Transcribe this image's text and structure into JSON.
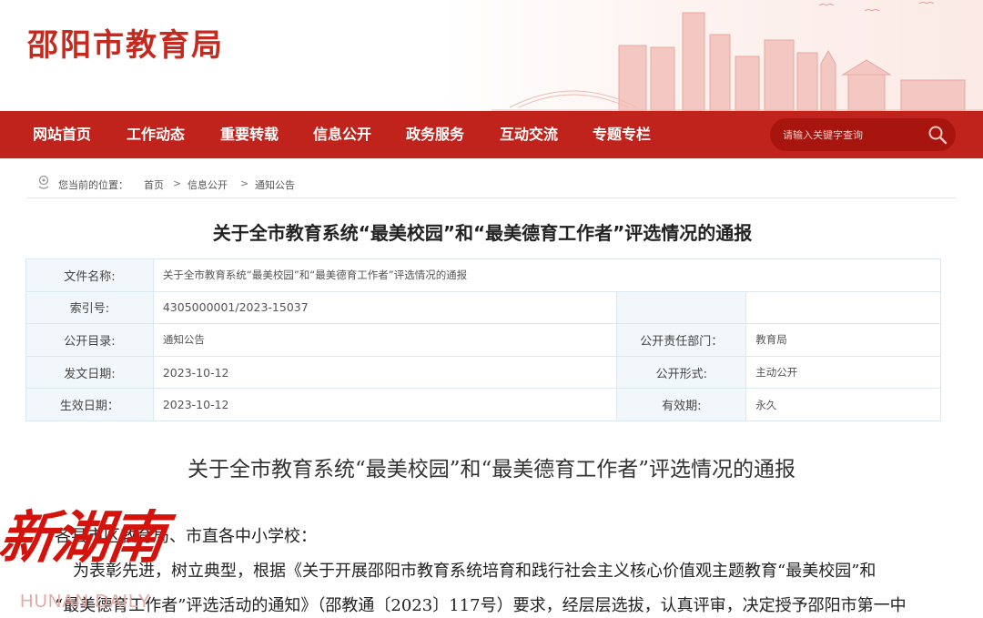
{
  "header": {
    "site_title": "邵阳市教育局"
  },
  "nav": {
    "items": [
      "网站首页",
      "工作动态",
      "重要转载",
      "信息公开",
      "政务服务",
      "互动交流",
      "专题专栏"
    ],
    "search_placeholder": "请输入关键字查询"
  },
  "breadcrumb": {
    "prefix": "您当前的位置：",
    "items": [
      "首页",
      "信息公开",
      "通知公告"
    ],
    "separator": ">"
  },
  "document": {
    "title": "关于全市教育系统“最美校园”和“最美德育工作者”评选情况的通报",
    "info": {
      "file_name_label": "文件名称:",
      "file_name": "关于全市教育系统“最美校园”和“最美德育工作者”评选情况的通报",
      "index_label": "索引号:",
      "index": "4305000001/2023-15037",
      "catalog_label": "公开目录:",
      "catalog": "通知公告",
      "dept_label": "公开责任部门：",
      "dept": "教育局",
      "issue_date_label": "发文日期:",
      "issue_date": "2023-10-12",
      "form_label": "公开形式:",
      "form": "主动公开",
      "effective_date_label": "生效日期：",
      "effective_date": "2023-10-12",
      "validity_label": "有效期:",
      "validity": "永久"
    },
    "body_title": "关于全市教育系统“最美校园”和“最美德育工作者”评选情况的通报",
    "para1": "各县市区教育局、市直各中小学校：",
    "para2": "为表彰先进，树立典型，根据《关于开展邵阳市教育系统培育和践行社会主义核心价值观主题教育“最美校园”和",
    "para3": "“最美德育工作者”评选活动的通知》（邵教通〔2023〕117号）要求，经层层选拔，认真评审，决定授予邵阳市第一中"
  },
  "watermark": {
    "logo": "新湖南",
    "sub": "HUNAN DAILY"
  }
}
